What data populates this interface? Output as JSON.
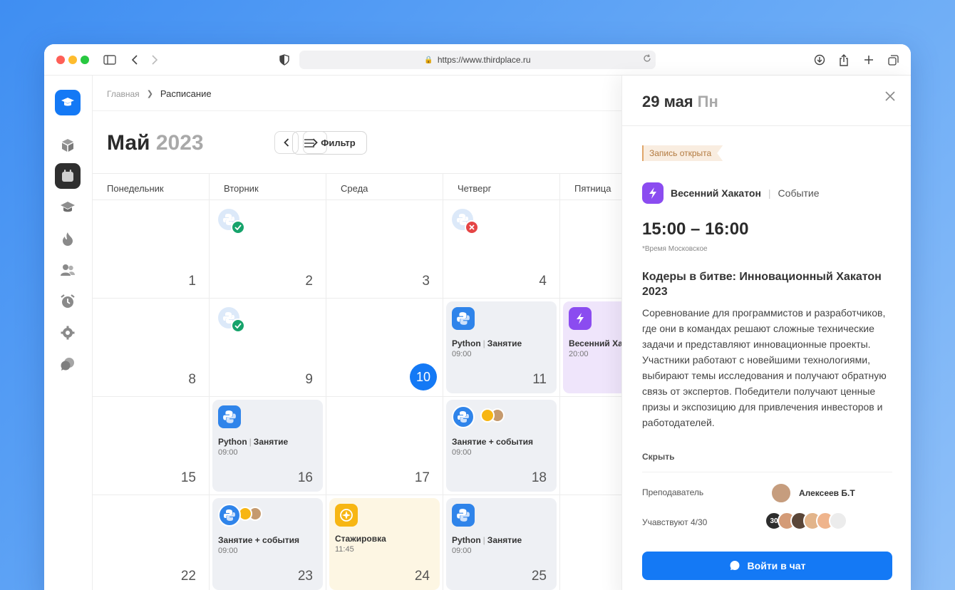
{
  "browser": {
    "url": "https://www.thirdplace.ru"
  },
  "breadcrumb": {
    "home": "Главная",
    "current": "Расписание"
  },
  "header": {
    "month": "Май",
    "year": "2023",
    "filter_label": "Фильтр"
  },
  "weekdays": [
    "Понедельник",
    "Вторник",
    "Среда",
    "Четверг",
    "Пятница"
  ],
  "calendar": {
    "today": "10",
    "days": [
      "1",
      "2",
      "3",
      "4",
      "8",
      "9",
      "10",
      "11",
      "15",
      "16",
      "17",
      "18",
      "22",
      "23",
      "24",
      "25"
    ],
    "events": {
      "d11": {
        "title": "Python",
        "type": "Занятие",
        "time": "09:00"
      },
      "d12": {
        "title": "Весенний Хакатон",
        "time": "20:00"
      },
      "d16": {
        "title": "Python",
        "type": "Занятие",
        "time": "09:00"
      },
      "d18": {
        "title": "Занятие + события",
        "time": "09:00"
      },
      "d23": {
        "title": "Занятие + события",
        "time": "09:00"
      },
      "d24": {
        "title": "Стажировка",
        "time": "11:45"
      },
      "d25": {
        "title": "Python",
        "type": "Занятие",
        "time": "09:00"
      }
    }
  },
  "panel": {
    "day": "29 мая",
    "weekday": "Пн",
    "status_badge": "Запись открыта",
    "event_name": "Весенний Хакатон",
    "event_type": "Событие",
    "time_range": "15:00 – 16:00",
    "timezone_note": "*Время Московское",
    "title": "Кодеры в битве: Инновационный Хакатон 2023",
    "description": "Соревнование для программистов и разработчиков, где они в командах решают сложные технические задачи и представляют инновационные проекты. Участники работают с новейшими технологиями, выбирают темы исследования и получают обратную связь от экспертов. Победители получают ценные призы и экспозицию для привлечения инвесторов и работодателей.",
    "hide_label": "Скрыть",
    "teacher_label": "Преподаватель",
    "teacher_name": "Алексеев Б.Т",
    "participants_label": "Учавствуют 4/30",
    "participants_count": "30",
    "chat_button": "Войти в чат"
  },
  "colors": {
    "accent": "#1479f5",
    "success": "#16a36b",
    "error": "#e54545",
    "event_purple": "#8b4cf0",
    "internship_yellow": "#f7b613"
  }
}
